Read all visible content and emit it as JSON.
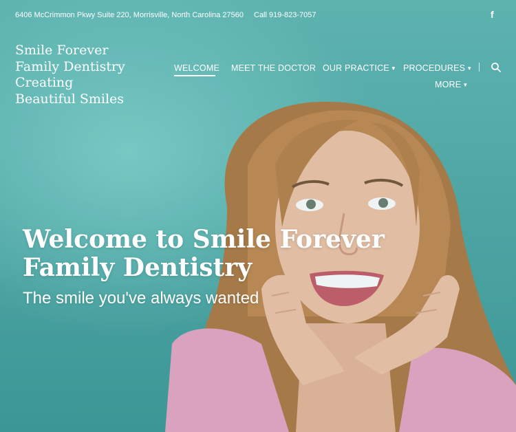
{
  "topbar": {
    "address": "6406 McCrimmon Pkwy Suite 220, Morrisville, North Carolina 27560",
    "phone": "Call 919-823-7057",
    "social_icon": "facebook-icon"
  },
  "logo": {
    "lines": [
      "Smile Forever",
      "Family Dentistry",
      "Creating",
      "Beautiful Smiles"
    ]
  },
  "nav": {
    "items": [
      {
        "label": "WELCOME",
        "active": true,
        "dropdown": false
      },
      {
        "label": "MEET THE DOCTOR",
        "active": false,
        "dropdown": false
      },
      {
        "label": "OUR PRACTICE",
        "active": false,
        "dropdown": true
      },
      {
        "label": "PROCEDURES",
        "active": false,
        "dropdown": true
      },
      {
        "label": "MORE",
        "active": false,
        "dropdown": true
      }
    ],
    "search_icon": "search-icon"
  },
  "hero": {
    "headline": "Welcome to Smile Forever Family Dentistry",
    "tagline": "The smile you've always wanted",
    "background_color": "#5fb8b4"
  }
}
